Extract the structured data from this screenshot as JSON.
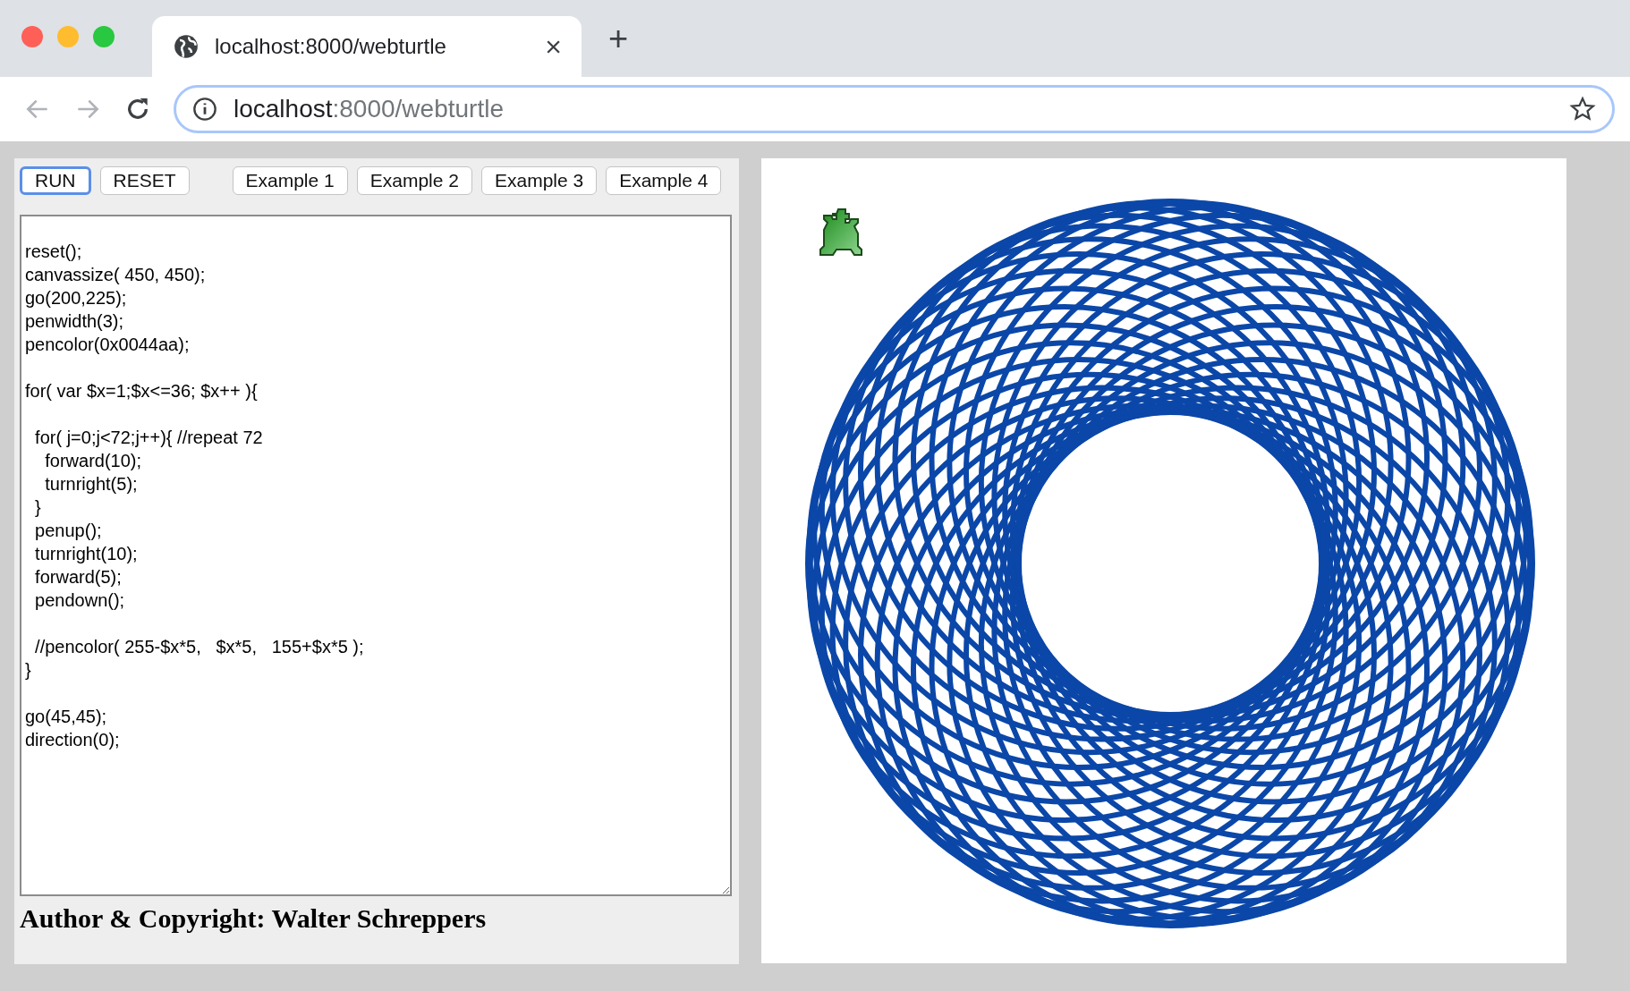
{
  "browser": {
    "tab": {
      "title": "localhost:8000/webturtle",
      "close": "×"
    },
    "new_tab": "+",
    "address": {
      "host": "localhost",
      "path": ":8000/webturtle"
    }
  },
  "controls": {
    "buttons": [
      {
        "label": "RUN",
        "focused": true
      },
      {
        "label": "RESET",
        "focused": false
      }
    ],
    "examples": [
      {
        "label": "Example 1",
        "focused": false
      },
      {
        "label": "Example 2",
        "focused": false
      },
      {
        "label": "Example 3",
        "focused": false
      },
      {
        "label": "Example 4",
        "focused": false
      }
    ]
  },
  "code": "\nreset();\ncanvassize( 450, 450);\ngo(200,225);\npenwidth(3);\npencolor(0x0044aa);\n\nfor( var $x=1;$x<=36; $x++ ){\n\n  for( j=0;j<72;j++){ //repeat 72\n    forward(10);\n    turnright(5);\n  }\n  penup();\n  turnright(10);\n  forward(5);\n  pendown();\n\n  //pencolor( 255-$x*5,   $x*5,   155+$x*5 );\n}\n\ngo(45,45);\ndirection(0);",
  "footer": "Author & Copyright: Walter Schreppers"
}
